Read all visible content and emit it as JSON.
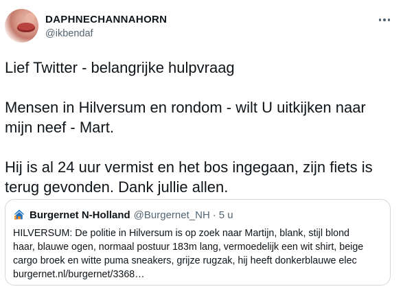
{
  "tweet": {
    "author": {
      "display_name": "DAPHNECHANNAHORN",
      "handle": "@ikbendaf"
    },
    "more_icon": "more-horizontal-icon",
    "text_lines": [
      "Lief Twitter - belangrijke hulpvraag",
      "Mensen in Hilversum en rondom - wilt U uitkijken naar",
      "mijn neef - Mart.",
      "Hij is al 24 uur vermist en het bos ingegaan, zijn fiets is",
      "terug gevonden.  Dank jullie allen."
    ]
  },
  "quoted_tweet": {
    "logo_icon": "burgernet-house-icon",
    "display_name": "Burgernet N-Holland",
    "handle": "@Burgernet_NH",
    "separator": "·",
    "time": "5 u",
    "body_lines": [
      "HILVERSUM: De politie in Hilversum is op zoek naar Martijn, blank, stijl blond",
      "haar, blauwe ogen, normaal postuur 183m lang, vermoedelijk een wit shirt, beige",
      "cargo broek en witte puma sneakers, grijze rugzak, hij heeft donkerblauwe elec",
      "burgernet.nl/burgernet/3368…"
    ]
  },
  "colors": {
    "text": "#0f1419",
    "secondary": "#536471",
    "border": "#cfd9de",
    "burgernet_blue": "#1d72c4"
  }
}
